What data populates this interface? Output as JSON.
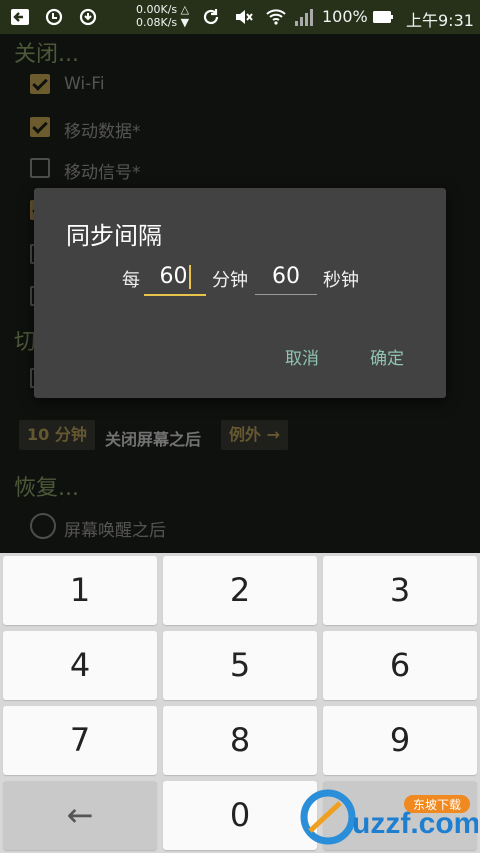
{
  "status_bar": {
    "speed_up": "0.00K/s △",
    "speed_down": "0.08K/s ▼",
    "battery": "100%",
    "time": "上午9:31",
    "icons": [
      "back-box-icon",
      "sync-icon",
      "sync-icon",
      "refresh-icon",
      "mute-icon",
      "wifi-icon",
      "signal-icon",
      "battery-icon"
    ]
  },
  "background": {
    "section_close": "关闭...",
    "items": [
      {
        "label": "Wi-Fi",
        "checked": true
      },
      {
        "label": "移动数据*",
        "checked": true
      },
      {
        "label": "移动信号*",
        "checked": false
      }
    ],
    "chip_minutes": "10 分钟",
    "after_screen_off": "关闭屏幕之后",
    "exceptions": "例外 →",
    "section_restore": "恢复...",
    "radio_label": "屏幕唤醒之后"
  },
  "dialog": {
    "title": "同步间隔",
    "every": "每",
    "minutes_value": "60",
    "minutes_unit": "分钟",
    "seconds_value": "60",
    "seconds_unit": "秒钟",
    "cancel": "取消",
    "ok": "确定"
  },
  "keyboard": {
    "keys": [
      "1",
      "2",
      "3",
      "4",
      "5",
      "6",
      "7",
      "8",
      "9",
      "←",
      "0",
      ""
    ]
  },
  "watermark": {
    "text": "uzzf.com",
    "tag": "东坡下载"
  }
}
